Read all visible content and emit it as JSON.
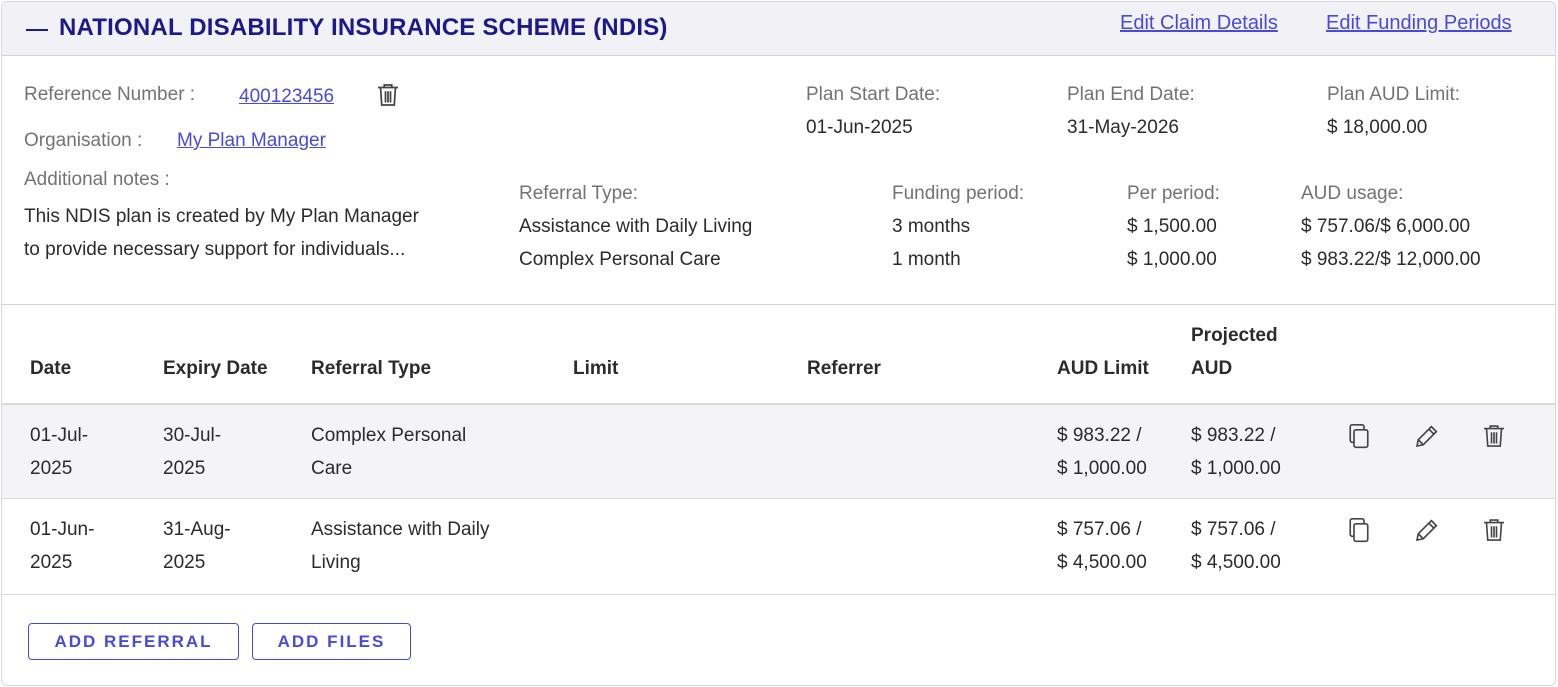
{
  "header": {
    "title": "NATIONAL DISABILITY INSURANCE SCHEME (NDIS)",
    "edit_claim_label": "Edit Claim Details",
    "edit_funding_label": "Edit Funding Periods"
  },
  "details": {
    "reference_label": "Reference Number :",
    "reference_value": "400123456",
    "organisation_label": "Organisation :",
    "organisation_value": "My Plan Manager",
    "notes_label": "Additional notes :",
    "notes_line1": "This NDIS plan is created by My Plan Manager",
    "notes_line2": "to provide necessary support for individuals...",
    "plan_start_label": "Plan Start Date:",
    "plan_start_value": "01-Jun-2025",
    "plan_end_label": "Plan End Date:",
    "plan_end_value": "31-May-2026",
    "plan_limit_label": "Plan AUD Limit:",
    "plan_limit_value": "$ 18,000.00"
  },
  "funding": {
    "headers": {
      "referral_type": "Referral Type:",
      "funding_period": "Funding period:",
      "per_period": "Per period:",
      "usage": "AUD usage:"
    },
    "rows": [
      {
        "referral_type": "Assistance with Daily Living",
        "funding_period": "3 months",
        "per_period": "$ 1,500.00",
        "usage": "$ 757.06/$ 6,000.00"
      },
      {
        "referral_type": "Complex Personal Care",
        "funding_period": "1 month",
        "per_period": "$ 1,000.00",
        "usage": "$ 983.22/$ 12,000.00"
      }
    ]
  },
  "table": {
    "columns": {
      "date": "Date",
      "expiry": "Expiry Date",
      "referral_type": "Referral Type",
      "limit": "Limit",
      "referrer": "Referrer",
      "aud_limit": "AUD Limit",
      "projected_1": "Projected",
      "projected_2": "AUD"
    },
    "rows": [
      {
        "date_1": "01-Jul-",
        "date_2": "2025",
        "expiry_1": "30-Jul-",
        "expiry_2": "2025",
        "type_1": "Complex Personal",
        "type_2": "Care",
        "limit": "",
        "referrer": "",
        "aud_1": "$ 983.22 /",
        "aud_2": "$ 1,000.00",
        "proj_1": "$ 983.22 /",
        "proj_2": "$ 1,000.00"
      },
      {
        "date_1": "01-Jun-",
        "date_2": "2025",
        "expiry_1": "31-Aug-",
        "expiry_2": "2025",
        "type_1": "Assistance with Daily",
        "type_2": "Living",
        "limit": "",
        "referrer": "",
        "aud_1": "$ 757.06 /",
        "aud_2": "$ 4,500.00",
        "proj_1": "$ 757.06 /",
        "proj_2": "$ 4,500.00"
      }
    ]
  },
  "actions": {
    "add_referral_label": "ADD REFERRAL",
    "add_files_label": "ADD FILES"
  },
  "colors": {
    "title": "#1c1a8a",
    "link": "#4a4ad8",
    "header_bg": "#f1f1f6",
    "row_highlight": "#f4f4f7"
  },
  "icons": [
    "collapse-icon",
    "trash-icon",
    "copy-icon",
    "pencil-icon"
  ]
}
